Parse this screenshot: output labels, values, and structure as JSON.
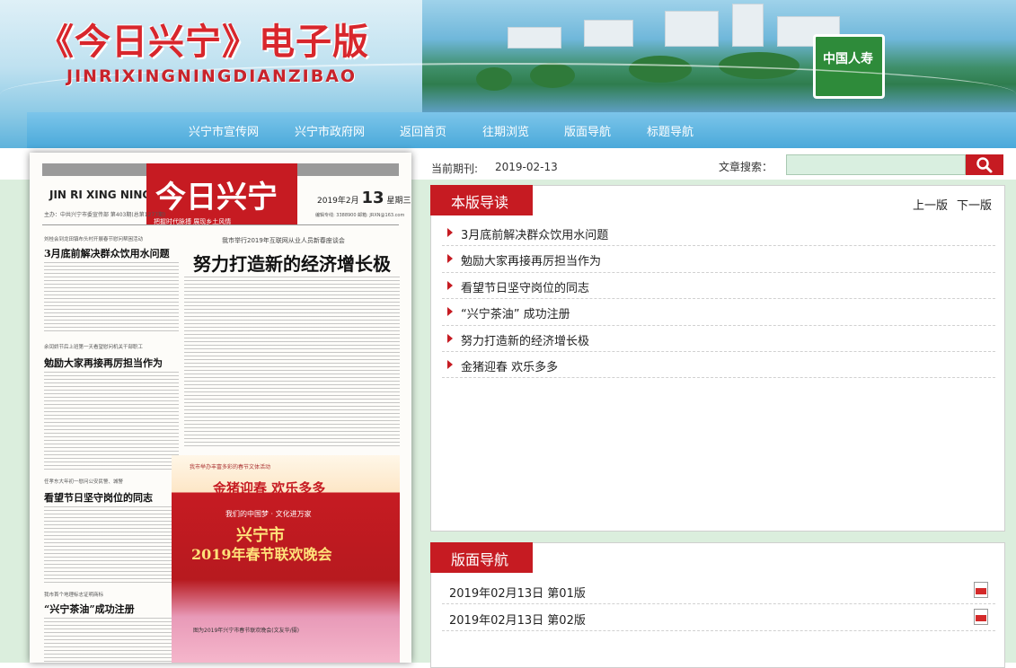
{
  "header": {
    "title": "《今日兴宁》电子版",
    "subtitle": "JINRIXINGNINGDIANZIBAO",
    "sign_text": "中国人寿"
  },
  "nav": [
    "兴宁市宣传网",
    "兴宁市政府网",
    "返回首页",
    "往期浏览",
    "版面导航",
    "标题导航"
  ],
  "issue": {
    "label": "当前期刊:",
    "date": "2019-02-13"
  },
  "search": {
    "label": "文章搜索：",
    "value": ""
  },
  "newspaper": {
    "masthead_left": "JIN RI XING NING",
    "logo": "今日兴宁",
    "date_text": "2019年2月",
    "day": "13",
    "weekday": "星期三",
    "slogan": "把握时代脉搏 展现乡土风情",
    "info_left": "主办：中共兴宁市委宣传部  第403期(总第1277期)",
    "info_right": "编辑专线: 3388900  邮箱: JRXN@163.com",
    "head1_pre": "刘桂会到龙田镇布头村开展春节慰问帮困活动",
    "head1": "3月底前解决群众饮用水问题",
    "lead_pre": "我市举行2019年互联网从业人员新春座谈会",
    "lead": "努力打造新的经济增长极",
    "head2_pre": "余闰娇节后上班第一天看望慰问机关干部职工",
    "head2": "勉励大家再接再厉担当作为",
    "head3_pre": "任孝东大年初一慰问公安民警、城警",
    "head3": "看望节日坚守岗位的同志",
    "head4_pre": "我市首个地理标志证明商标",
    "head4": "“兴宁茶油”成功注册",
    "promo_top": "我市举办丰富多彩的春节文体活动",
    "promo_title": "金猪迎春  欢乐多多",
    "promo_band": "我们的中国梦 · 文化进万家",
    "promo_city": "兴宁市",
    "promo_show": "2019年春节联欢晚会",
    "promo_caption": "图为2019年兴宁市春节联欢晚会(文友华/摄)"
  },
  "panel_articles": {
    "tab": "本版导读",
    "prev": "上一版",
    "next": "下一版",
    "items": [
      "3月底前解决群众饮用水问题",
      "勉励大家再接再厉担当作为",
      "看望节日坚守岗位的同志",
      "“兴宁茶油” 成功注册",
      "努力打造新的经济增长极",
      "金猪迎春  欢乐多多"
    ]
  },
  "panel_pages": {
    "tab": "版面导航",
    "items": [
      "2019年02月13日  第01版",
      "2019年02月13日  第02版"
    ]
  },
  "colors": {
    "accent": "#c61b22",
    "nav": "#4aa9da"
  }
}
